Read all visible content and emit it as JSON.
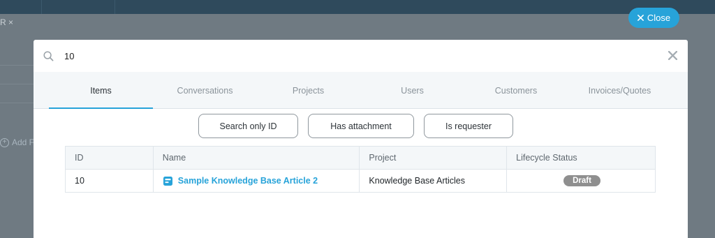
{
  "background": {
    "tab_fragment": "R ×",
    "add_fragment": "Add F"
  },
  "close_button": {
    "label": "Close"
  },
  "search": {
    "value": "10",
    "placeholder": ""
  },
  "tabs": [
    {
      "label": "Items",
      "active": true
    },
    {
      "label": "Conversations",
      "active": false
    },
    {
      "label": "Projects",
      "active": false
    },
    {
      "label": "Users",
      "active": false
    },
    {
      "label": "Customers",
      "active": false
    },
    {
      "label": "Invoices/Quotes",
      "active": false
    }
  ],
  "filters": [
    {
      "label": "Search only ID"
    },
    {
      "label": "Has attachment"
    },
    {
      "label": "Is requester"
    }
  ],
  "table": {
    "columns": [
      "ID",
      "Name",
      "Project",
      "Lifecycle Status"
    ],
    "rows": [
      {
        "id": "10",
        "name": "Sample Knowledge Base Article 2",
        "name_icon": "article-icon",
        "project": "Knowledge Base Articles",
        "status": "Draft"
      }
    ]
  },
  "colors": {
    "accent": "#27a3d9",
    "badge_gray": "#8f8f8f",
    "overlay": "#6f7a82"
  }
}
